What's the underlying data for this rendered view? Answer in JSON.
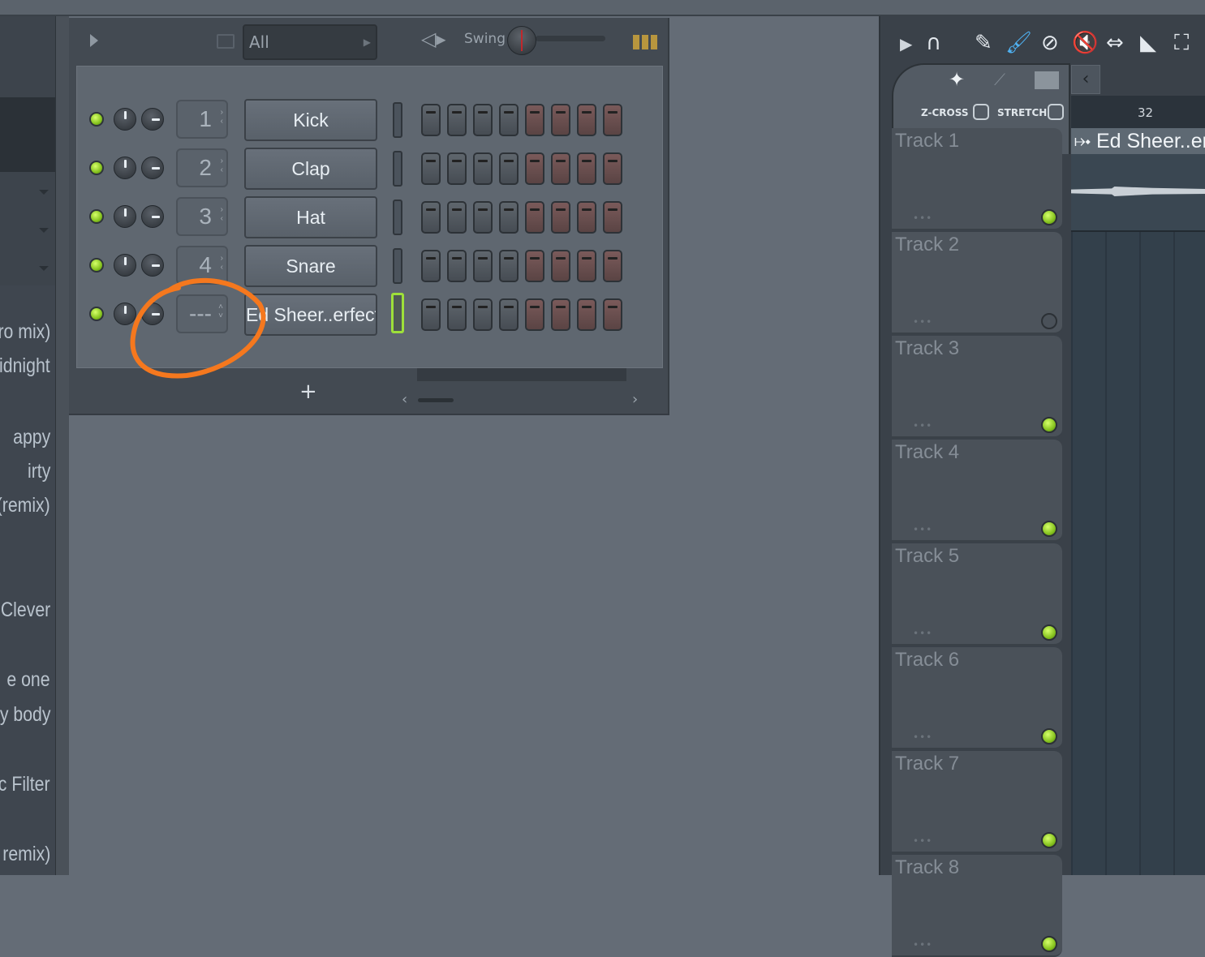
{
  "browser": {
    "items": [
      "ro mix)",
      "idnight",
      "appy",
      "irty",
      "(remix)",
      "Clever",
      "e one",
      "My body",
      "ic Filter",
      "n remix)"
    ]
  },
  "channel_rack": {
    "filter_label": "All",
    "swing_label": "Swing",
    "add_label": "+",
    "channels": [
      {
        "mixer_track": "1",
        "name": "Kick",
        "selected": false
      },
      {
        "mixer_track": "2",
        "name": "Clap",
        "selected": false
      },
      {
        "mixer_track": "3",
        "name": "Hat",
        "selected": false
      },
      {
        "mixer_track": "4",
        "name": "Snare",
        "selected": false
      },
      {
        "mixer_track": "---",
        "name": "Ed Sheer..erfect",
        "selected": true
      }
    ],
    "steps_per_channel": 8,
    "accent_color": "#9ee03a",
    "annotation_color": "#f5781e"
  },
  "playlist": {
    "zcross_label": "Z-CROSS",
    "stretch_label": "STRETCH",
    "ruler_bar": "32",
    "clip_name": "Ed Sheer..erfe",
    "tracks": [
      {
        "name": "Track 1",
        "active": true
      },
      {
        "name": "Track 2",
        "active": false
      },
      {
        "name": "Track 3",
        "active": true
      },
      {
        "name": "Track 4",
        "active": true
      },
      {
        "name": "Track 5",
        "active": true
      },
      {
        "name": "Track 6",
        "active": true
      },
      {
        "name": "Track 7",
        "active": true
      },
      {
        "name": "Track 8",
        "active": true
      }
    ]
  }
}
